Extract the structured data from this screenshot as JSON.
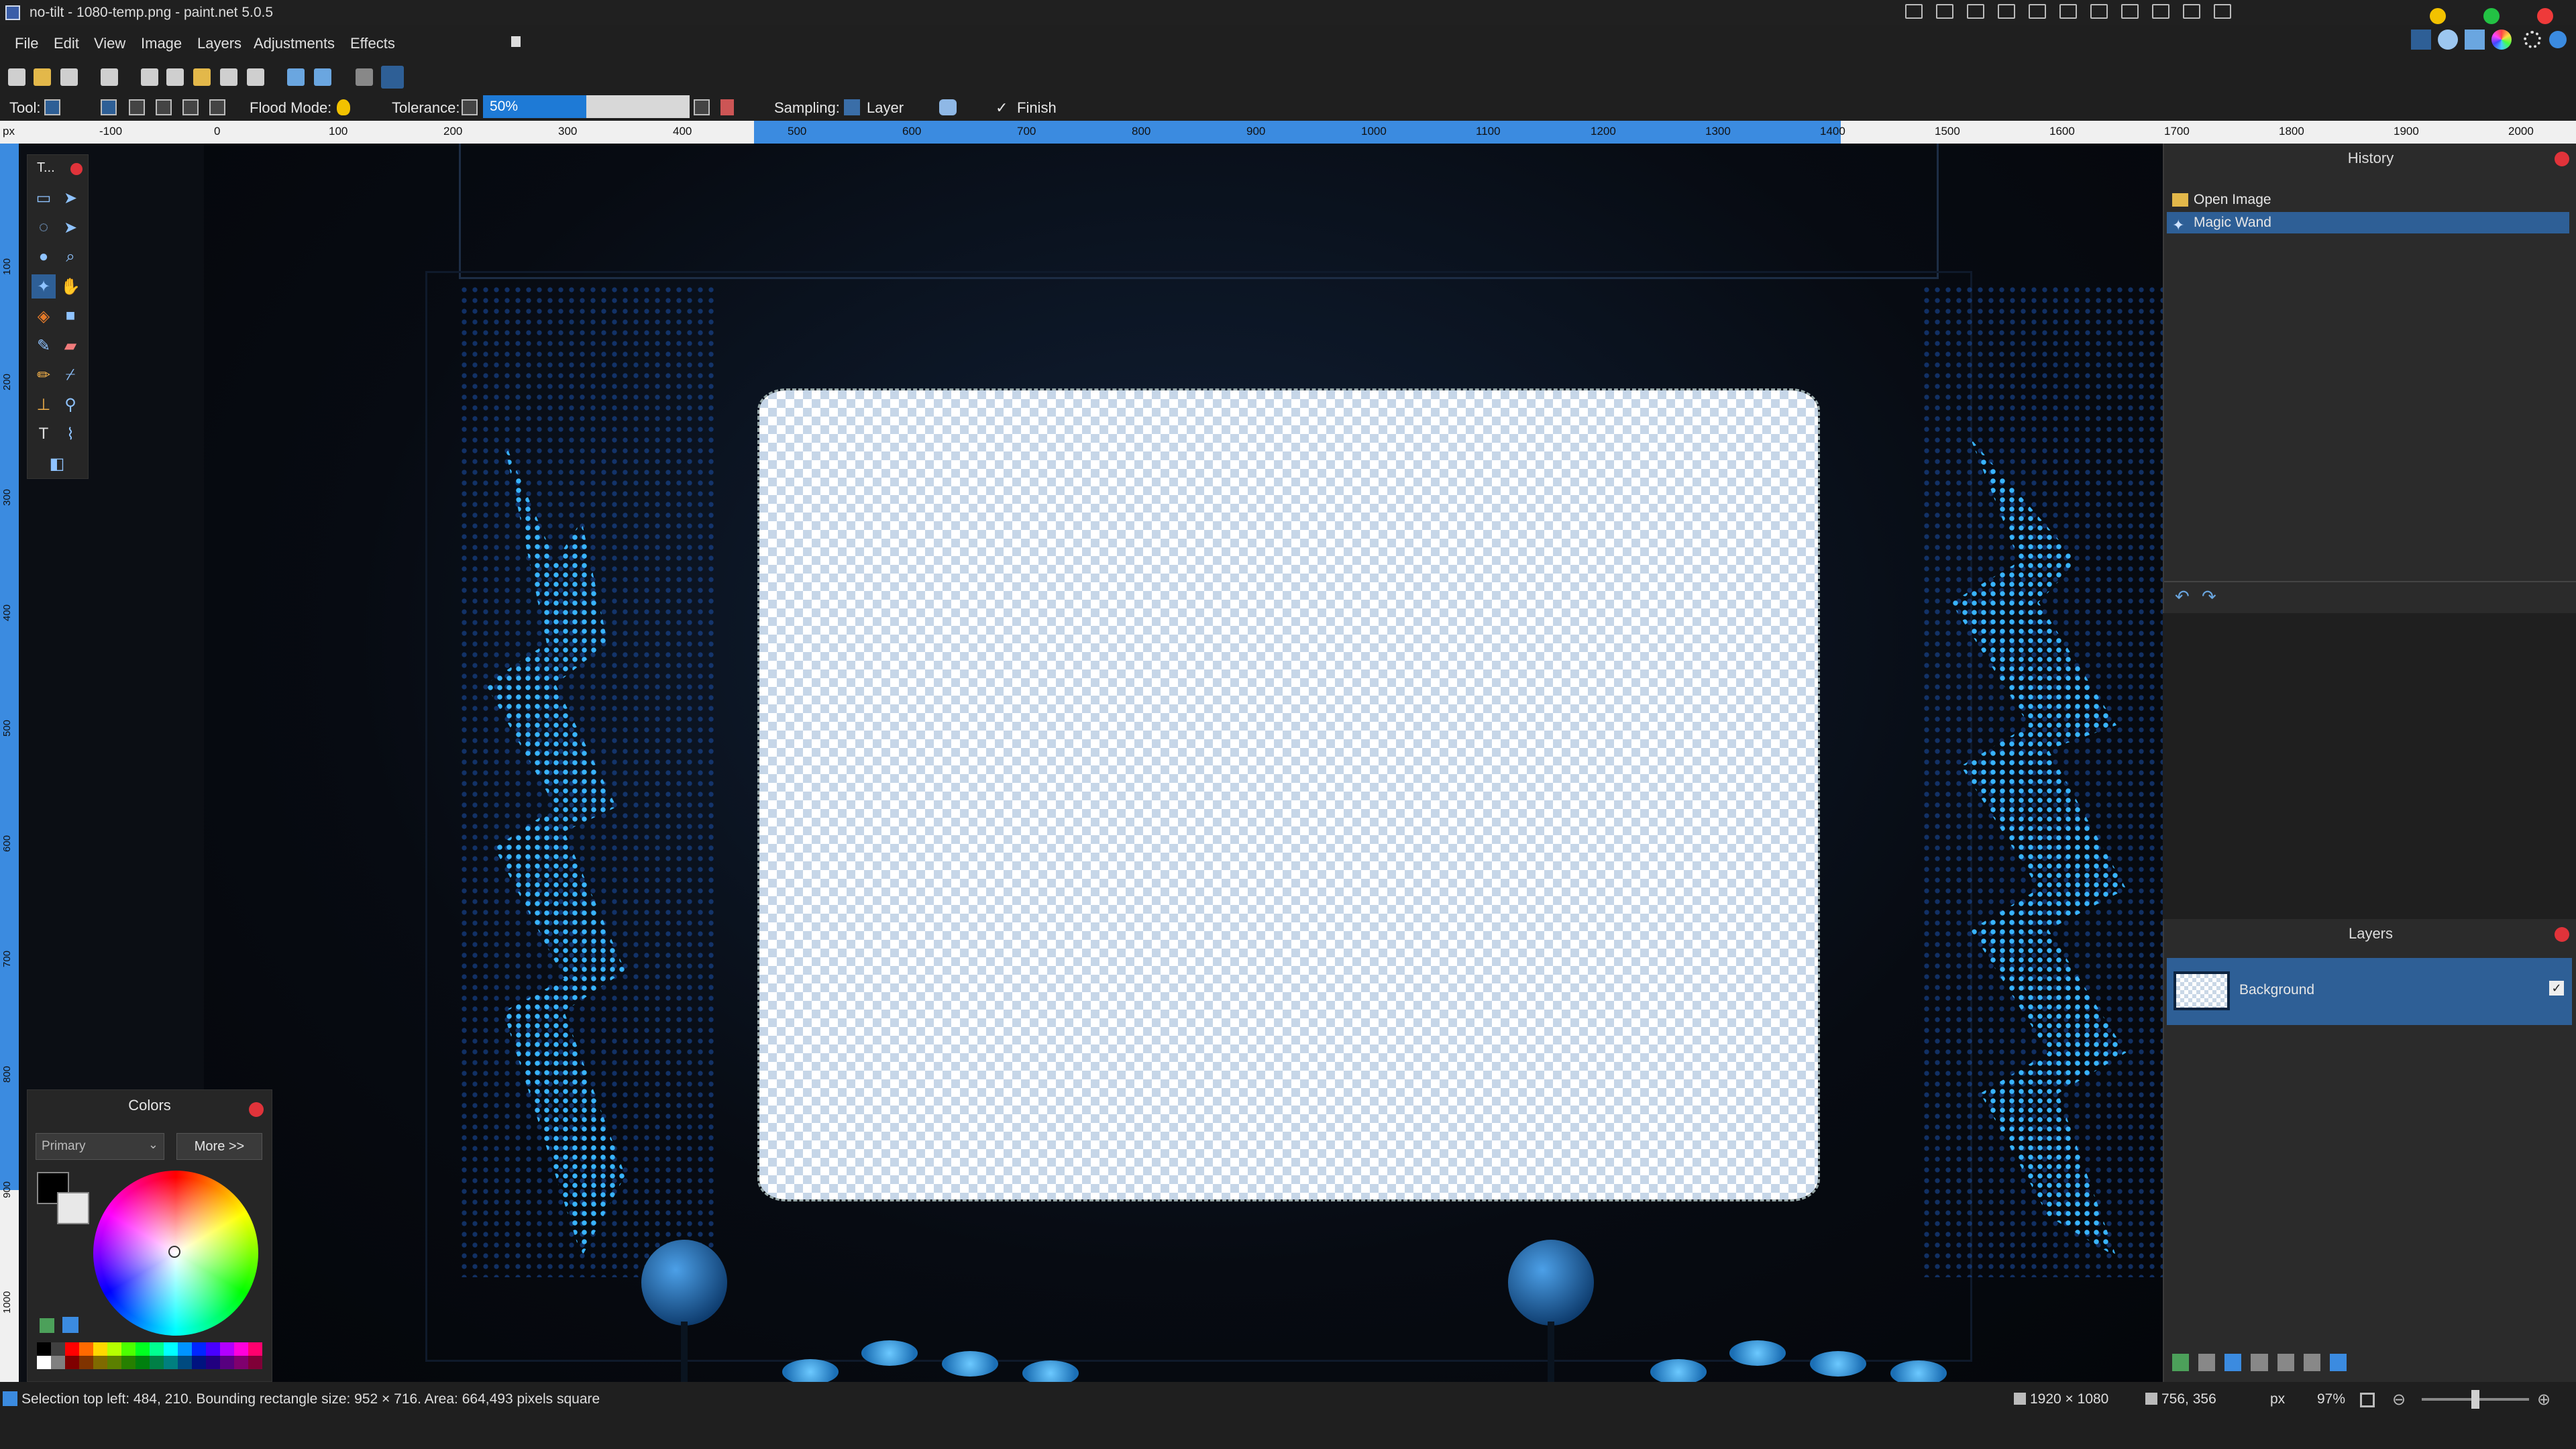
{
  "window": {
    "title": "no-tilt - 1080-temp.png - paint.net 5.0.5"
  },
  "menu": [
    "File",
    "Edit",
    "View",
    "Image",
    "Layers",
    "Adjustments",
    "Effects"
  ],
  "options": {
    "tool_label": "Tool:",
    "flood_mode_label": "Flood Mode:",
    "tolerance_label": "Tolerance:",
    "tolerance_value": "50%",
    "tolerance_fraction": 0.5,
    "sampling_label": "Sampling:",
    "sampling_value": "Layer",
    "finish_label": "Finish"
  },
  "ruler": {
    "unit": "px",
    "h_ticks": [
      "-100",
      "0",
      "100",
      "200",
      "300",
      "400",
      "500",
      "600",
      "700",
      "800",
      "900",
      "1000",
      "1100",
      "1200",
      "1300",
      "1400",
      "1500",
      "1600",
      "1700",
      "1800",
      "1900",
      "2000"
    ],
    "v_ticks": [
      "100",
      "200",
      "300",
      "400",
      "500",
      "600",
      "700",
      "800",
      "900",
      "1000"
    ]
  },
  "tools_panel": {
    "title": "T..."
  },
  "colors_panel": {
    "title": "Colors",
    "mode": "Primary",
    "more_button": "More >>",
    "palette": [
      "#000000",
      "#404040",
      "#ff0000",
      "#ff6a00",
      "#ffd800",
      "#b6ff00",
      "#4cff00",
      "#00ff21",
      "#00ff90",
      "#00ffff",
      "#0094ff",
      "#0026ff",
      "#4800ff",
      "#b200ff",
      "#ff00dc",
      "#ff006e",
      "#ffffff",
      "#808080",
      "#7f0000",
      "#7f3300",
      "#7f6a00",
      "#5b7f00",
      "#267f00",
      "#007f0e",
      "#007f46",
      "#007f7f",
      "#004a7f",
      "#00137f",
      "#21007f",
      "#57007f",
      "#7f006e",
      "#7f0037"
    ]
  },
  "history": {
    "title": "History",
    "items": [
      {
        "label": "Open Image",
        "icon": "folder-icon",
        "selected": false
      },
      {
        "label": "Magic Wand",
        "icon": "magic-wand-icon",
        "selected": true
      }
    ]
  },
  "layers": {
    "title": "Layers",
    "items": [
      {
        "name": "Background",
        "visible": true
      }
    ]
  },
  "status": {
    "selection_info": "Selection top left: 484, 210. Bounding rectangle size: 952 × 716. Area: 664,493 pixels square",
    "image_size": "1920 × 1080",
    "cursor_pos": "756, 356",
    "units": "px",
    "zoom": "97%"
  },
  "colors": {
    "accent": "#2e5f96",
    "ruler_highlight": "#3b8be0",
    "close_dot": "#e0333a"
  }
}
